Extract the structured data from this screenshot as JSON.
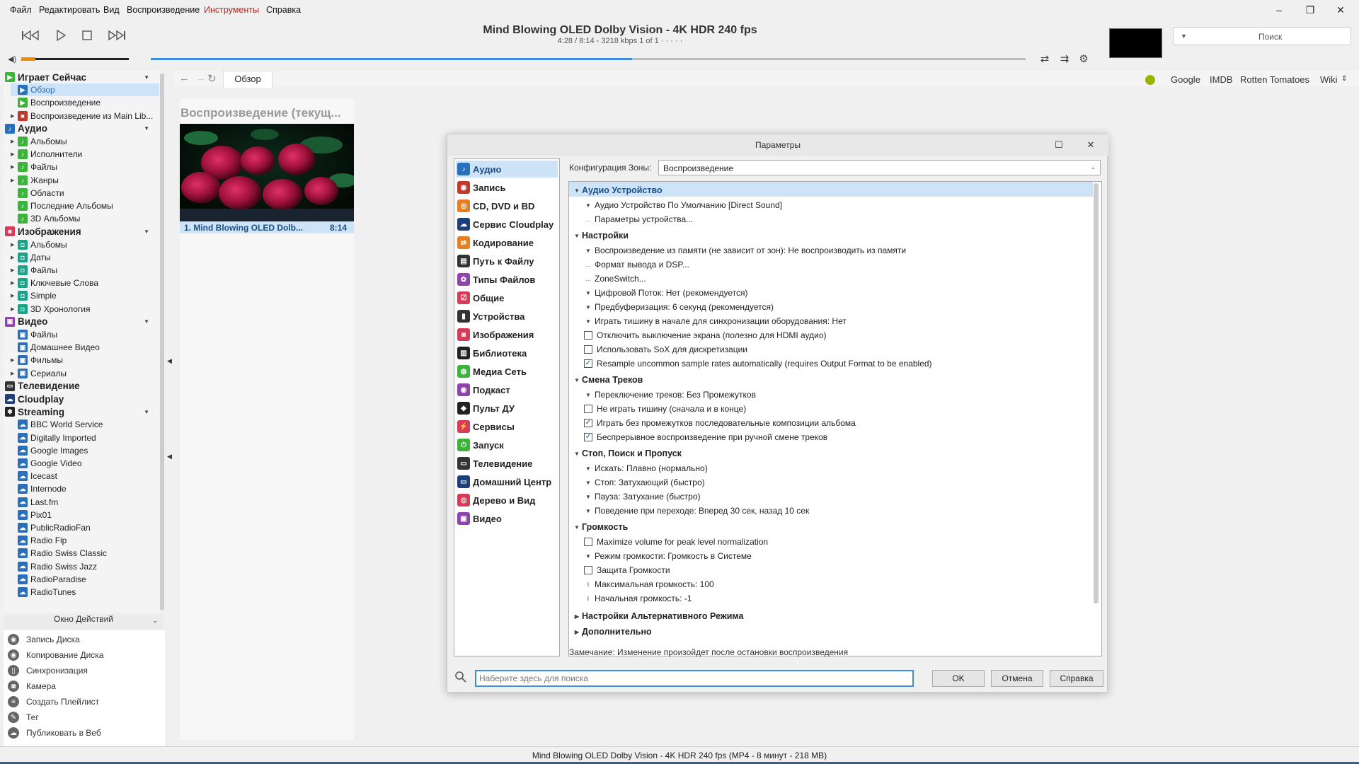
{
  "menu": {
    "items": [
      "Файл",
      "Редактировать",
      "Вид",
      "Воспроизведение",
      "Инструменты",
      "Справка"
    ],
    "active_color": "#c0241c"
  },
  "window_controls": {
    "minimize": "–",
    "maximize": "❐",
    "close": "✕"
  },
  "now_playing": {
    "title": "Mind Blowing OLED Dolby Vision - 4K HDR 240 fps",
    "info": "4:28 / 8:14 - 3218 kbps  1 of 1  ·  ·  ·  ·  ·",
    "progress": 0.55,
    "volume": 0.13
  },
  "top_search": {
    "placeholder": "Поиск"
  },
  "tree": {
    "rows": [
      {
        "label": "Играет Сейчас",
        "level": 0,
        "top": true,
        "chev": true,
        "color": "#3cb43c",
        "glyph": "▶"
      },
      {
        "label": "Обзор",
        "level": 1,
        "sel": true,
        "color": "#2a6fbb",
        "glyph": "▶"
      },
      {
        "label": "Воспроизведение",
        "level": 1,
        "color": "#3cb43c",
        "glyph": "▶"
      },
      {
        "label": "Воспроизведение из Main Lib...",
        "level": 1,
        "exp": true,
        "color": "#c0392b",
        "glyph": "■"
      },
      {
        "label": "Аудио",
        "level": 0,
        "top": true,
        "chev": true,
        "color": "#2a6fbb",
        "glyph": "♪"
      },
      {
        "label": "Альбомы",
        "level": 1,
        "exp": true,
        "color": "#3cb43c",
        "glyph": "♪"
      },
      {
        "label": "Исполнители",
        "level": 1,
        "exp": true,
        "color": "#3cb43c",
        "glyph": "♪"
      },
      {
        "label": "Файлы",
        "level": 1,
        "exp": true,
        "color": "#3cb43c",
        "glyph": "♪"
      },
      {
        "label": "Жанры",
        "level": 1,
        "exp": true,
        "color": "#3cb43c",
        "glyph": "♪"
      },
      {
        "label": "Области",
        "level": 1,
        "color": "#3cb43c",
        "glyph": "♪"
      },
      {
        "label": "Последние Альбомы",
        "level": 1,
        "color": "#3cb43c",
        "glyph": "♪"
      },
      {
        "label": "3D Альбомы",
        "level": 1,
        "color": "#3cb43c",
        "glyph": "♪"
      },
      {
        "label": "Изображения",
        "level": 0,
        "top": true,
        "chev": true,
        "color": "#d63b5a",
        "glyph": "◙"
      },
      {
        "label": "Альбомы",
        "level": 1,
        "exp": true,
        "color": "#17a589",
        "glyph": "◘"
      },
      {
        "label": "Даты",
        "level": 1,
        "exp": true,
        "color": "#17a589",
        "glyph": "◘"
      },
      {
        "label": "Файлы",
        "level": 1,
        "exp": true,
        "color": "#17a589",
        "glyph": "◘"
      },
      {
        "label": "Ключевые Слова",
        "level": 1,
        "exp": true,
        "color": "#17a589",
        "glyph": "◘"
      },
      {
        "label": "Simple",
        "level": 1,
        "exp": true,
        "color": "#17a589",
        "glyph": "◘"
      },
      {
        "label": "3D Хронология",
        "level": 1,
        "exp": true,
        "color": "#17a589",
        "glyph": "◘"
      },
      {
        "label": "Видео",
        "level": 0,
        "top": true,
        "chev": true,
        "color": "#8e44ad",
        "glyph": "▣"
      },
      {
        "label": "Файлы",
        "level": 1,
        "color": "#2a6fbb",
        "glyph": "▣"
      },
      {
        "label": "Домашнее Видео",
        "level": 1,
        "color": "#2a6fbb",
        "glyph": "▣"
      },
      {
        "label": "Фильмы",
        "level": 1,
        "exp": true,
        "color": "#2a6fbb",
        "glyph": "▣"
      },
      {
        "label": "Сериалы",
        "level": 1,
        "exp": true,
        "color": "#2a6fbb",
        "glyph": "▣"
      },
      {
        "label": "Телевидение",
        "level": 0,
        "top": true,
        "color": "#333333",
        "glyph": "▭"
      },
      {
        "label": "Cloudplay",
        "level": 0,
        "top": true,
        "color": "#1d3f7a",
        "glyph": "☁"
      },
      {
        "label": "Streaming",
        "level": 0,
        "top": true,
        "chev": true,
        "color": "#222222",
        "glyph": "✱"
      },
      {
        "label": "BBC World Service",
        "level": 1,
        "color": "#2a6fbb",
        "glyph": "☁"
      },
      {
        "label": "Digitally Imported",
        "level": 1,
        "color": "#2a6fbb",
        "glyph": "☁"
      },
      {
        "label": "Google Images",
        "level": 1,
        "color": "#2a6fbb",
        "glyph": "☁"
      },
      {
        "label": "Google Video",
        "level": 1,
        "color": "#2a6fbb",
        "glyph": "☁"
      },
      {
        "label": "Icecast",
        "level": 1,
        "color": "#2a6fbb",
        "glyph": "☁"
      },
      {
        "label": "Internode",
        "level": 1,
        "color": "#2a6fbb",
        "glyph": "☁"
      },
      {
        "label": "Last.fm",
        "level": 1,
        "color": "#2a6fbb",
        "glyph": "☁"
      },
      {
        "label": "Pix01",
        "level": 1,
        "color": "#2a6fbb",
        "glyph": "☁"
      },
      {
        "label": "PublicRadioFan",
        "level": 1,
        "color": "#2a6fbb",
        "glyph": "☁"
      },
      {
        "label": "Radio Fip",
        "level": 1,
        "color": "#2a6fbb",
        "glyph": "☁"
      },
      {
        "label": "Radio Swiss Classic",
        "level": 1,
        "color": "#2a6fbb",
        "glyph": "☁"
      },
      {
        "label": "Radio Swiss Jazz",
        "level": 1,
        "color": "#2a6fbb",
        "glyph": "☁"
      },
      {
        "label": "RadioParadise",
        "level": 1,
        "color": "#2a6fbb",
        "glyph": "☁"
      },
      {
        "label": "RadioTunes",
        "level": 1,
        "color": "#2a6fbb",
        "glyph": "☁"
      }
    ]
  },
  "actions": {
    "header": "Окно Действий",
    "items": [
      {
        "label": "Запись Диска",
        "glyph": "◉"
      },
      {
        "label": "Копирование Диска",
        "glyph": "◉"
      },
      {
        "label": "Синхронизация",
        "glyph": "▯"
      },
      {
        "label": "Камера",
        "glyph": "◙"
      },
      {
        "label": "Создать Плейлист",
        "glyph": "≡"
      },
      {
        "label": "Тег",
        "glyph": "✎"
      },
      {
        "label": "Публиковать в Веб",
        "glyph": "☁"
      }
    ]
  },
  "content": {
    "tab": "Обзор",
    "links": [
      "Google",
      "IMDB",
      "Rotten Tomatoes",
      "Wiki"
    ],
    "playing_header": "Воспроизведение (текущ...",
    "item_title": "1. Mind Blowing OLED Dolb...",
    "item_duration": "8:14"
  },
  "dialog": {
    "title": "Параметры",
    "categories": [
      {
        "label": "Аудио",
        "color": "#2a6fbb",
        "glyph": "♪",
        "sel": true
      },
      {
        "label": "Запись",
        "color": "#c0392b",
        "glyph": "◉"
      },
      {
        "label": "CD, DVD и BD",
        "color": "#e67e22",
        "glyph": "◎"
      },
      {
        "label": "Сервис Cloudplay",
        "color": "#1d3f7a",
        "glyph": "☁"
      },
      {
        "label": "Кодирование",
        "color": "#e67e22",
        "glyph": "⇄"
      },
      {
        "label": "Путь к Файлу",
        "color": "#333333",
        "glyph": "▤"
      },
      {
        "label": "Типы Файлов",
        "color": "#8e44ad",
        "glyph": "✿"
      },
      {
        "label": "Общие",
        "color": "#d63b5a",
        "glyph": "☑"
      },
      {
        "label": "Устройства",
        "color": "#333333",
        "glyph": "▮"
      },
      {
        "label": "Изображения",
        "color": "#d63b5a",
        "glyph": "◙"
      },
      {
        "label": "Библиотека",
        "color": "#222222",
        "glyph": "▥"
      },
      {
        "label": "Медиа Сеть",
        "color": "#3cb43c",
        "glyph": "◍"
      },
      {
        "label": "Подкаст",
        "color": "#8e44ad",
        "glyph": "◉"
      },
      {
        "label": "Пульт ДУ",
        "color": "#222222",
        "glyph": "◆"
      },
      {
        "label": "Сервисы",
        "color": "#d63b5a",
        "glyph": "⚡"
      },
      {
        "label": "Запуск",
        "color": "#3cb43c",
        "glyph": "⏻"
      },
      {
        "label": "Телевидение",
        "color": "#333333",
        "glyph": "▭"
      },
      {
        "label": "Домашний Центр",
        "color": "#1d3f7a",
        "glyph": "▭"
      },
      {
        "label": "Дерево и Вид",
        "color": "#d63b5a",
        "glyph": "◎"
      },
      {
        "label": "Видео",
        "color": "#8e44ad",
        "glyph": "▣"
      }
    ],
    "zone_label": "Конфигурация Зоны:",
    "zone_value": "Воспроизведение",
    "options": [
      {
        "t": "hdr",
        "label": "Аудио Устройство",
        "sel": true
      },
      {
        "t": "dd",
        "label": "Аудио Устройство По Умолчанию [Direct Sound]"
      },
      {
        "t": "dots",
        "label": "Параметры устройства..."
      },
      {
        "t": "hdr",
        "label": "Настройки"
      },
      {
        "t": "dd",
        "label": "Воспроизведение из памяти (не зависит от зон): Не воспроизводить из памяти"
      },
      {
        "t": "dots",
        "label": "Формат вывода и DSP..."
      },
      {
        "t": "dots",
        "label": "ZoneSwitch..."
      },
      {
        "t": "dd",
        "label": "Цифровой Поток: Нет (рекомендуется)"
      },
      {
        "t": "dd",
        "label": "Предбуферизация: 6 секунд (рекомендуется)"
      },
      {
        "t": "dd",
        "label": "Играть тишину в начале для синхронизации оборудования: Нет"
      },
      {
        "t": "cb",
        "label": "Отключить выключение экрана (полезно для HDMI аудио)",
        "checked": false
      },
      {
        "t": "cb",
        "label": "Использовать SoX для дискретизации",
        "checked": false
      },
      {
        "t": "cb",
        "label": "Resample uncommon sample rates automatically (requires Output Format to be enabled)",
        "checked": true
      },
      {
        "t": "hdr",
        "label": "Смена Треков"
      },
      {
        "t": "dd",
        "label": "Переключение треков: Без Промежутков"
      },
      {
        "t": "cb",
        "label": "Не играть тишину (сначала и в конце)",
        "checked": false
      },
      {
        "t": "cb",
        "label": "Играть без промежутков последовательные композиции альбома",
        "checked": true
      },
      {
        "t": "cb",
        "label": "Беспрерывное воспроизведение при ручной смене треков",
        "checked": true
      },
      {
        "t": "hdr",
        "label": "Стоп, Поиск и Пропуск"
      },
      {
        "t": "dd",
        "label": "Искать: Плавно (нормально)"
      },
      {
        "t": "dd",
        "label": "Стоп: Затухающий (быстро)"
      },
      {
        "t": "dd",
        "label": "Пауза: Затухание (быстро)"
      },
      {
        "t": "dd",
        "label": "Поведение при переходе: Вперед 30 сек, назад 10 сек"
      },
      {
        "t": "hdr",
        "label": "Громкость"
      },
      {
        "t": "cb",
        "label": "Maximize volume for peak level normalization",
        "checked": false
      },
      {
        "t": "dd",
        "label": "Режим громкости: Громкость в Системе"
      },
      {
        "t": "cb",
        "label": "Защита Громкости",
        "checked": false
      },
      {
        "t": "num",
        "label": "Максимальная громкость: 100"
      },
      {
        "t": "num",
        "label": "Начальная громкость: -1"
      },
      {
        "t": "hdr2",
        "label": "Настройки Альтернативного Режима"
      },
      {
        "t": "hdr2",
        "label": "Дополнительно"
      }
    ],
    "note": "Замечание: Изменение произойдет после остановки воспроизведения",
    "search_placeholder": "Наберите здесь для поиска",
    "btn_ok": "OK",
    "btn_cancel": "Отмена",
    "btn_help": "Справка"
  },
  "status": "Mind Blowing OLED Dolby Vision - 4K HDR 240 fps (MP4 - 8 минут - 218 MB)",
  "accent": "#3a8de0"
}
